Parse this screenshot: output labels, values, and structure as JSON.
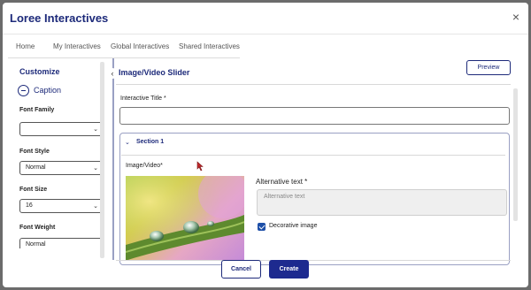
{
  "app": {
    "title": "Loree Interactives",
    "close_icon": "×"
  },
  "tabs": [
    {
      "label": "Home"
    },
    {
      "label": "My Interactives"
    },
    {
      "label": "Global Interactives"
    },
    {
      "label": "Shared Interactives"
    }
  ],
  "sidebar": {
    "title": "Customize",
    "caption_label": "Caption",
    "collapse_icon": "‹",
    "fields": [
      {
        "label": "Font Family",
        "value": ""
      },
      {
        "label": "Font Style",
        "value": "Normal"
      },
      {
        "label": "Font Size",
        "value": "16"
      },
      {
        "label": "Font Weight",
        "value": "Normal"
      }
    ]
  },
  "main": {
    "title": "Image/Video Slider",
    "preview_label": "Preview",
    "interactive_title_label": "Interactive Title *",
    "interactive_title_value": "",
    "section": {
      "title": "Section 1",
      "image_label": "Image/Video*",
      "alt_label": "Alternative text *",
      "alt_placeholder": "Alternative text",
      "decorative_label": "Decorative image",
      "decorative_checked": true
    }
  },
  "footer": {
    "cancel_label": "Cancel",
    "create_label": "Create"
  },
  "colors": {
    "brand": "#1d2a7a",
    "primary_button": "#1d2a8f",
    "checkbox": "#1d4fa8"
  },
  "icons": {
    "chevron_down": "chevron-down-icon",
    "collapse": "chevron-left-icon",
    "caption_toggle": "minus-circle-icon",
    "section_toggle": "chevron-down-icon"
  }
}
